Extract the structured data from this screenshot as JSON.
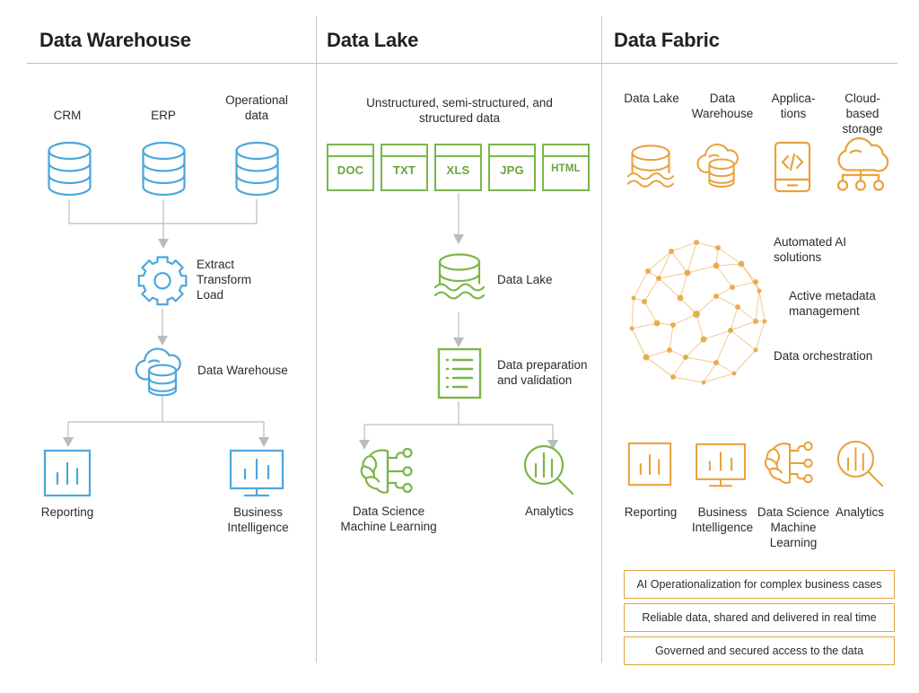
{
  "colors": {
    "blue": "#4da6dc",
    "green": "#7ab648",
    "orange": "#e9a13b",
    "connector": "#b9bcbe",
    "rule": "#bfbfbf",
    "text": "#2b2b2b",
    "title": "#231f20"
  },
  "columns": {
    "warehouse": {
      "title": "Data Warehouse",
      "sources": [
        {
          "label": "CRM",
          "icon": "database-cylinder-icon"
        },
        {
          "label": "ERP",
          "icon": "database-cylinder-icon"
        },
        {
          "label": "Operational\ndata",
          "icon": "database-cylinder-icon"
        }
      ],
      "etl": {
        "label": "Extract\nTransform\nLoad",
        "icon": "gear-icon"
      },
      "store": {
        "label": "Data Warehouse",
        "icon": "cloud-database-icon"
      },
      "outputs": [
        {
          "label": "Reporting",
          "icon": "bar-chart-square-icon"
        },
        {
          "label": "Business\nIntelligence",
          "icon": "monitor-chart-icon"
        }
      ]
    },
    "lake": {
      "title": "Data Lake",
      "intro": "Unstructured, semi-structured, and\nstructured data",
      "file_types": [
        "DOC",
        "TXT",
        "XLS",
        "JPG",
        "HTML"
      ],
      "store": {
        "label": "Data Lake",
        "icon": "lake-cylinder-icon"
      },
      "prep": {
        "label": "Data preparation\nand validation",
        "icon": "checklist-document-icon"
      },
      "outputs": [
        {
          "label": "Data Science\nMachine Learning",
          "icon": "brain-circuit-icon"
        },
        {
          "label": "Analytics",
          "icon": "magnifier-chart-icon"
        }
      ]
    },
    "fabric": {
      "title": "Data Fabric",
      "sources": [
        {
          "label": "Data Lake",
          "icon": "lake-cylinder-icon"
        },
        {
          "label": "Data\nWarehouse",
          "icon": "cloud-database-icon"
        },
        {
          "label": "Applica-\ntions",
          "icon": "mobile-code-icon"
        },
        {
          "label": "Cloud-\nbased\nstorage",
          "icon": "cloud-network-icon"
        }
      ],
      "mesh": {
        "icon": "network-mesh-icon"
      },
      "capabilities": [
        "Automated AI\nsolutions",
        "Active metadata\nmanagement",
        "Data orchestration"
      ],
      "outputs": [
        {
          "label": "Reporting",
          "icon": "bar-chart-square-icon"
        },
        {
          "label": "Business\nIntelligence",
          "icon": "monitor-chart-icon"
        },
        {
          "label": "Data Science\nMachine\nLearning",
          "icon": "brain-circuit-icon"
        },
        {
          "label": "Analytics",
          "icon": "magnifier-chart-icon"
        }
      ],
      "callouts": [
        "AI Operationalization for complex business cases",
        "Reliable data, shared and delivered in real time",
        "Governed and secured access to the data"
      ]
    }
  }
}
